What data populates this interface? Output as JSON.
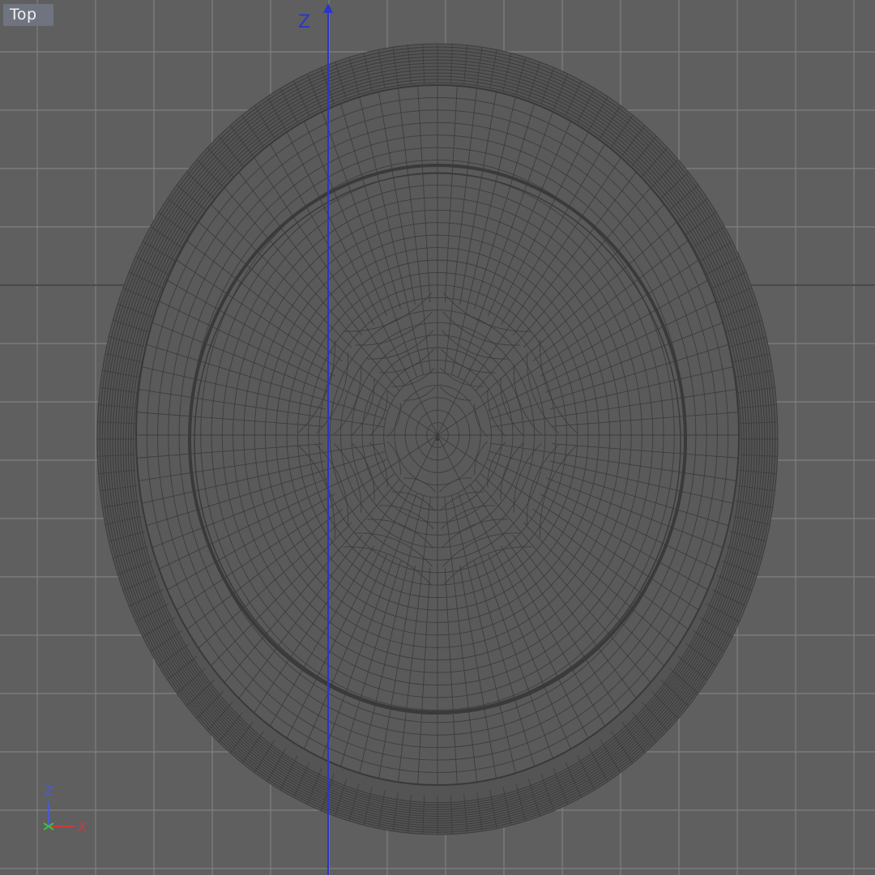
{
  "viewport": {
    "view_name": "Top",
    "background_color": "#5f5f5f",
    "grid_color": "#808080",
    "grid_major_color": "#494949",
    "mesh_line_color": "#3a3a3a",
    "axis_color": "#2b35c8"
  },
  "world_axis": {
    "label": "Z"
  },
  "gizmo": {
    "z_label": "Z",
    "y_label": "Y",
    "x_label": "X",
    "z_color": "#4a5ad8",
    "y_color": "#3fbf3f",
    "x_color": "#c83c3c"
  },
  "model": {
    "icon": "wireframe-ellipsoid-mesh"
  }
}
